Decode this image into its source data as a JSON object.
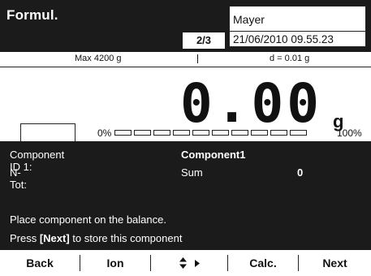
{
  "header": {
    "title": "Formul.",
    "page_indicator": "2/3",
    "user": "Mayer",
    "datetime": "21/06/2010 09.55.23"
  },
  "scale": {
    "max_capacity": "Max 4200 g",
    "resolution": "d = 0.01 g"
  },
  "display": {
    "weight": "0.00",
    "unit": "g",
    "progress_min": "0%",
    "progress_max": "100%",
    "progress_value": 0
  },
  "panel": {
    "component_label": "Component ID 1:",
    "component_value": "Component1",
    "ntot_label": "N-Tot:",
    "sum_label": "Sum",
    "sum_value": "0",
    "message_line1": "Place component on the balance.",
    "message_line2_prefix": "Press ",
    "message_line2_key": "[Next]",
    "message_line2_suffix": " to store this component"
  },
  "softkeys": {
    "back": "Back",
    "ion": "Ion",
    "nav_icons": [
      "up-down-arrows-icon",
      "right-arrow-icon"
    ],
    "calc": "Calc.",
    "next": "Next"
  },
  "colors": {
    "header_bg": "#1b1b1b",
    "panel_bg": "#1b1b1b",
    "text_light": "#ffffff",
    "text_dark": "#111111"
  }
}
